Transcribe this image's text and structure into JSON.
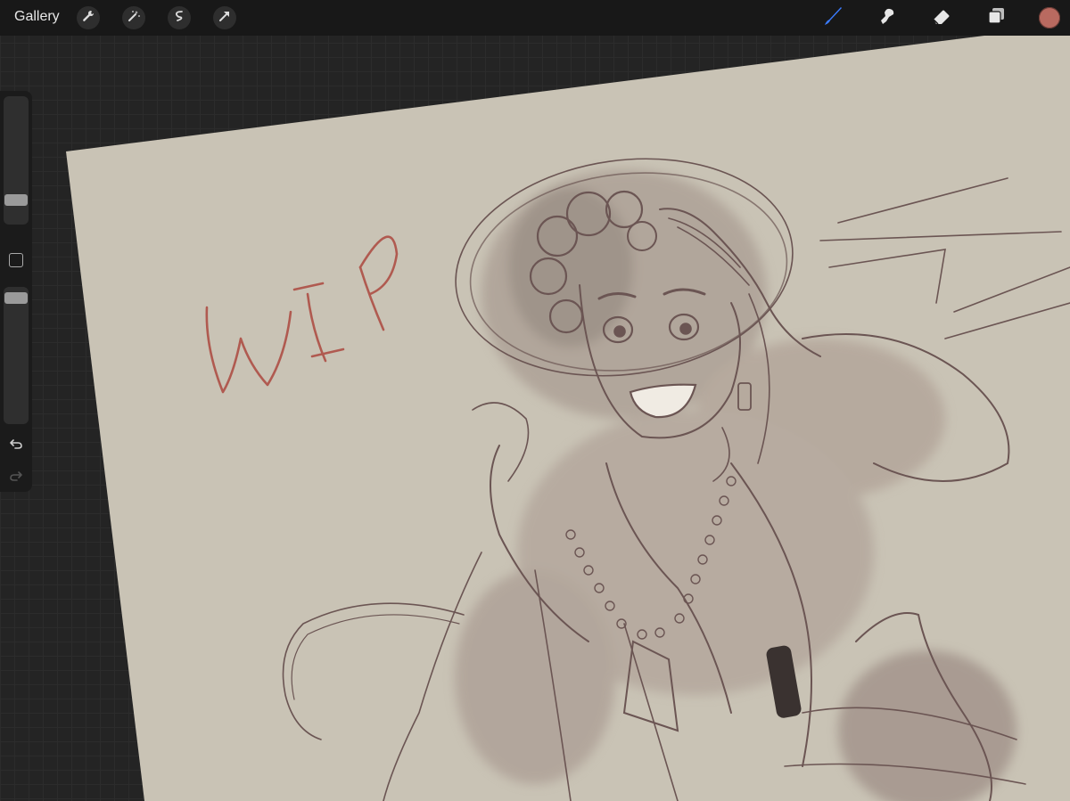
{
  "topbar": {
    "gallery_label": "Gallery",
    "left_tools": [
      "wrench-icon",
      "magic-wand-icon",
      "selection-icon",
      "transform-arrow-icon"
    ],
    "right_tools": [
      "brush-icon",
      "smudge-icon",
      "eraser-icon",
      "layers-icon"
    ],
    "active_tool": "brush-icon",
    "current_color": "#b96a60"
  },
  "sidebar": {
    "brush_size_level": 0.2,
    "opacity_level": 0.96
  },
  "canvas": {
    "paper_color": "#c9c3b5",
    "handwritten_text": "WIP",
    "handwritten_color": "#b05a50"
  },
  "colors": {
    "accent_blue": "#3a7bff",
    "ui_dark": "#181818"
  }
}
